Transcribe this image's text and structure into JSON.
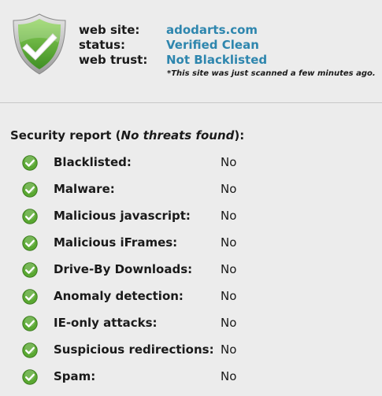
{
  "site_info": {
    "web_site_label": "web site:",
    "web_site_value": "adodarts.com",
    "status_label": "status:",
    "status_value": "Verified Clean",
    "web_trust_label": "web trust:",
    "web_trust_value": "Not Blacklisted",
    "scan_note": "*This site was just scanned a few minutes ago."
  },
  "report": {
    "heading_prefix": "Security report (",
    "heading_emphasis": "No threats found",
    "heading_suffix": "):",
    "items": [
      {
        "label": "Blacklisted:",
        "value": "No"
      },
      {
        "label": "Malware:",
        "value": "No"
      },
      {
        "label": "Malicious javascript:",
        "value": "No"
      },
      {
        "label": "Malicious iFrames:",
        "value": "No"
      },
      {
        "label": "Drive-By Downloads:",
        "value": "No"
      },
      {
        "label": "Anomaly detection:",
        "value": "No"
      },
      {
        "label": "IE-only attacks:",
        "value": "No"
      },
      {
        "label": "Suspicious redirections:",
        "value": "No"
      },
      {
        "label": "Spam:",
        "value": "No"
      }
    ]
  },
  "icons": {
    "shield": "shield-check-icon",
    "item": "check-circle-icon"
  },
  "colors": {
    "link": "#2e86ae",
    "check_green": "#5aa832",
    "background": "#ececec"
  }
}
